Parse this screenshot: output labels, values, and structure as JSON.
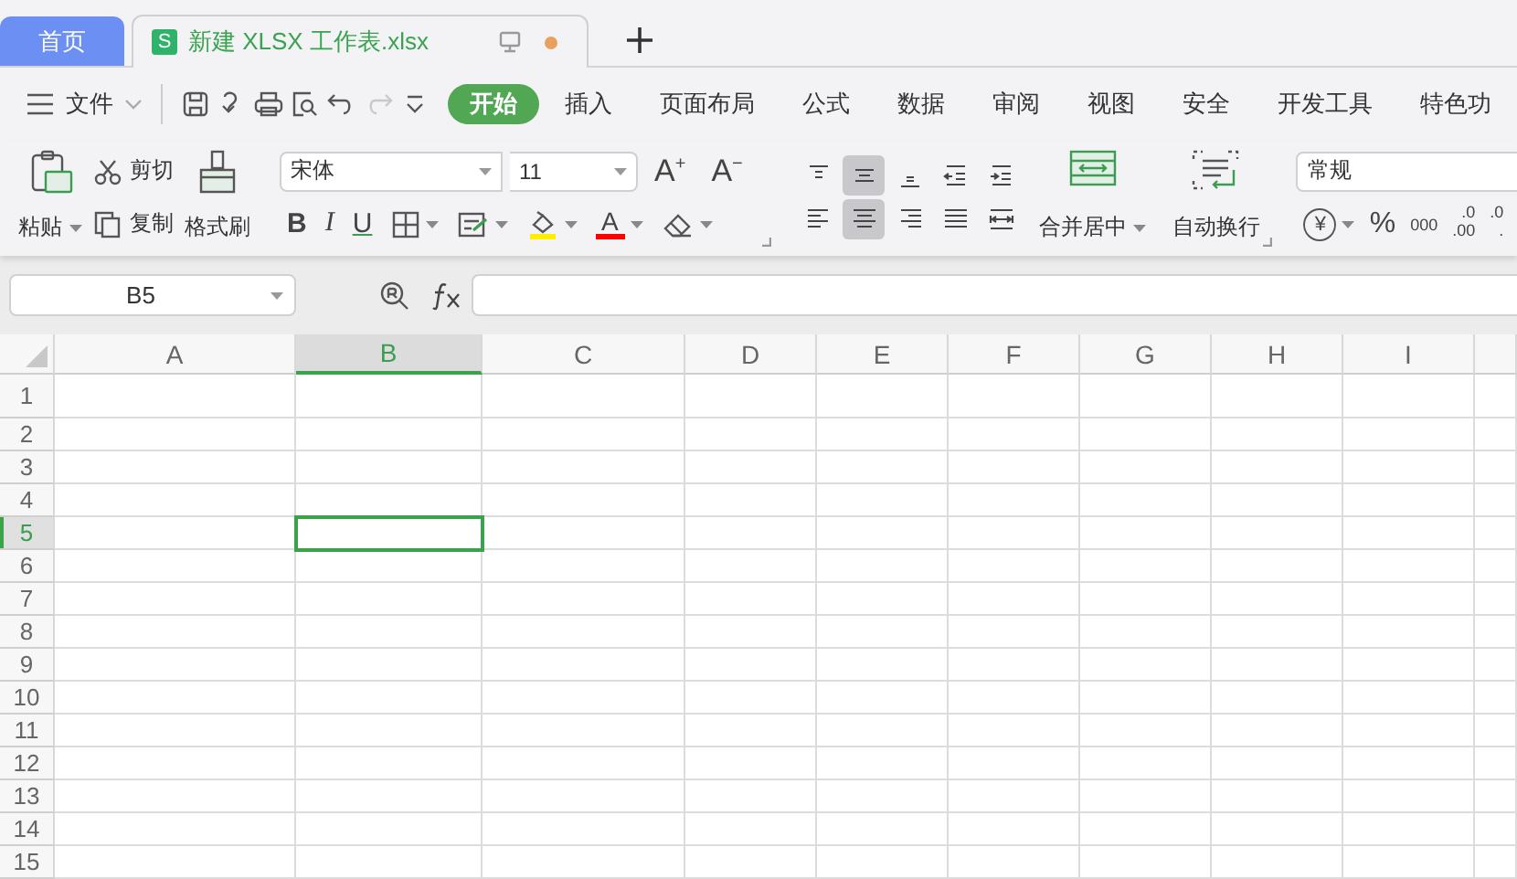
{
  "tabs": [
    {
      "label": "首页",
      "kind": "home",
      "selected": false
    },
    {
      "label": "新建 XLSX 工作表.xlsx",
      "kind": "document",
      "badge": "S",
      "modified": true,
      "selected": true
    }
  ],
  "file_menu": "文件",
  "quick_access": [
    {
      "kind": "save",
      "disabled": false
    },
    {
      "kind": "curl",
      "disabled": false
    },
    {
      "kind": "print",
      "disabled": false
    },
    {
      "kind": "preview",
      "disabled": false
    },
    {
      "kind": "undo",
      "disabled": false
    },
    {
      "kind": "redo",
      "disabled": true
    },
    {
      "kind": "customize",
      "disabled": false
    }
  ],
  "ribbon_tabs": [
    {
      "label": "开始",
      "selected": true
    },
    {
      "label": "插入",
      "selected": false
    },
    {
      "label": "页面布局",
      "selected": false
    },
    {
      "label": "公式",
      "selected": false
    },
    {
      "label": "数据",
      "selected": false
    },
    {
      "label": "审阅",
      "selected": false
    },
    {
      "label": "视图",
      "selected": false
    },
    {
      "label": "安全",
      "selected": false
    },
    {
      "label": "开发工具",
      "selected": false
    },
    {
      "label": "特色功",
      "selected": false
    }
  ],
  "clipboard": {
    "paste": "粘贴",
    "cut": "剪切",
    "copy": "复制",
    "format_painter": "格式刷"
  },
  "font": {
    "name": "宋体",
    "size": "11",
    "grow": {
      "label": "A",
      "mark": "+"
    },
    "shrink": {
      "label": "A",
      "mark": "−"
    }
  },
  "font_buttons": [
    {
      "kind": "bold",
      "label": "B"
    },
    {
      "kind": "italic",
      "label": "I"
    },
    {
      "kind": "underline",
      "label": "U"
    },
    {
      "kind": "borders"
    },
    {
      "kind": "cell_style"
    },
    {
      "kind": "fill",
      "color": "#ffee00"
    },
    {
      "kind": "font_color",
      "label": "A",
      "color": "#ff0000"
    },
    {
      "kind": "clear"
    }
  ],
  "alignment": [
    {
      "kind": "top",
      "selected": false
    },
    {
      "kind": "middle",
      "selected": true
    },
    {
      "kind": "bottom",
      "selected": false
    },
    {
      "kind": "outdent",
      "selected": false
    },
    {
      "kind": "indent",
      "selected": false
    },
    {
      "kind": "left",
      "selected": false
    },
    {
      "kind": "center",
      "selected": true
    },
    {
      "kind": "right",
      "selected": false
    },
    {
      "kind": "justify",
      "selected": false
    },
    {
      "kind": "distributed",
      "selected": false
    }
  ],
  "merge": "合并居中",
  "wrap": "自动换行",
  "number_format": "常规",
  "number_buttons": [
    {
      "kind": "currency",
      "label": "¥"
    },
    {
      "kind": "percent",
      "label": "%"
    },
    {
      "kind": "thousands",
      "label": "000"
    },
    {
      "kind": "add_decimal",
      "labels": [
        ".0",
        ".00"
      ]
    },
    {
      "kind": "remove_decimal",
      "labels": [
        ".0",
        "."
      ]
    }
  ],
  "name_box": "B5",
  "columns": [
    {
      "label": "A",
      "selected": false
    },
    {
      "label": "B",
      "selected": true
    },
    {
      "label": "C",
      "selected": false
    },
    {
      "label": "D",
      "selected": false
    },
    {
      "label": "E",
      "selected": false
    },
    {
      "label": "F",
      "selected": false
    },
    {
      "label": "G",
      "selected": false
    },
    {
      "label": "H",
      "selected": false
    },
    {
      "label": "I",
      "selected": false
    }
  ],
  "rows": [
    {
      "label": "1",
      "selected": false
    },
    {
      "label": "2",
      "selected": false
    },
    {
      "label": "3",
      "selected": false
    },
    {
      "label": "4",
      "selected": false
    },
    {
      "label": "5",
      "selected": true
    },
    {
      "label": "6",
      "selected": false
    },
    {
      "label": "7",
      "selected": false
    },
    {
      "label": "8",
      "selected": false
    },
    {
      "label": "9",
      "selected": false
    },
    {
      "label": "10",
      "selected": false
    },
    {
      "label": "11",
      "selected": false
    },
    {
      "label": "12",
      "selected": false
    },
    {
      "label": "13",
      "selected": false
    },
    {
      "label": "14",
      "selected": false
    },
    {
      "label": "15",
      "selected": false
    }
  ]
}
